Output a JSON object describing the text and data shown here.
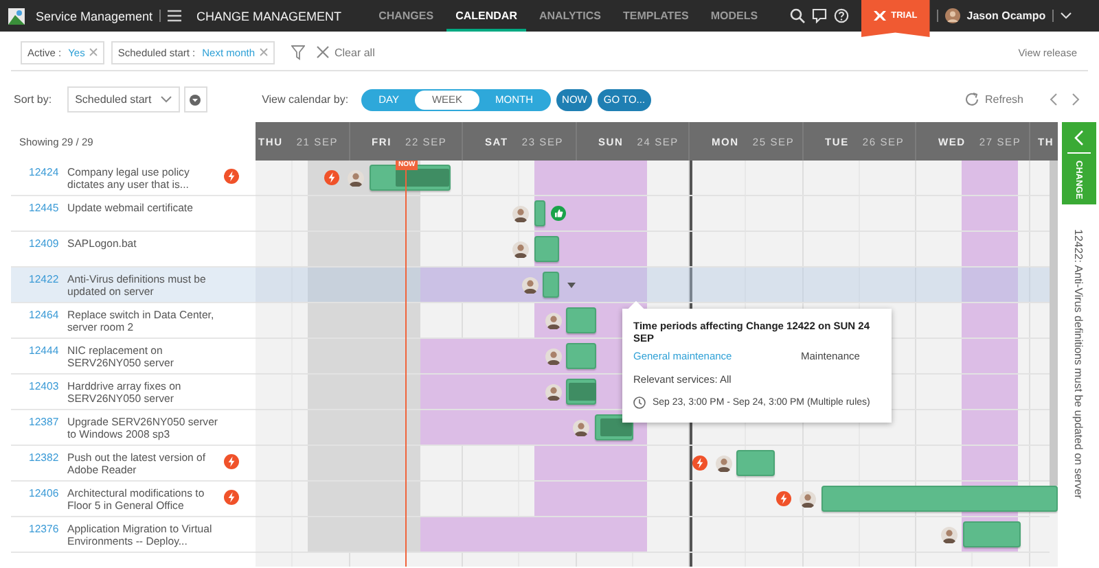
{
  "app": {
    "title": "Service Management",
    "module": "CHANGE MANAGEMENT",
    "trial": "TRIAL",
    "user": "Jason Ocampo"
  },
  "nav_tabs": [
    {
      "label": "CHANGES",
      "selected": false
    },
    {
      "label": "CALENDAR",
      "selected": true
    },
    {
      "label": "ANALYTICS",
      "selected": false
    },
    {
      "label": "TEMPLATES",
      "selected": false
    },
    {
      "label": "MODELS",
      "selected": false
    }
  ],
  "filters": [
    {
      "label": "Active :",
      "value": "Yes"
    },
    {
      "label": "Scheduled start :",
      "value": "Next month"
    }
  ],
  "clear_all": "Clear all",
  "view_release": "View release",
  "sort": {
    "label": "Sort by:",
    "value": "Scheduled start"
  },
  "view": {
    "label": "View calendar by:",
    "options": [
      {
        "label": "DAY",
        "selected": false
      },
      {
        "label": "WEEK",
        "selected": true
      },
      {
        "label": "MONTH",
        "selected": false
      }
    ]
  },
  "now_button": "NOW",
  "goto_button": "GO TO...",
  "refresh": "Refresh",
  "showing": "Showing 29 / 29",
  "days": [
    {
      "day": "THU",
      "date": "21 SEP"
    },
    {
      "day": "FRI",
      "date": "22 SEP"
    },
    {
      "day": "SAT",
      "date": "23 SEP"
    },
    {
      "day": "SUN",
      "date": "24 SEP"
    },
    {
      "day": "MON",
      "date": "25 SEP"
    },
    {
      "day": "TUE",
      "date": "26 SEP"
    },
    {
      "day": "WED",
      "date": "27 SEP"
    },
    {
      "day": "TH"
    }
  ],
  "now_marker": "NOW",
  "changes": [
    {
      "id": "12424",
      "title": "Company legal use policy dictates any user that is...",
      "emergency": true,
      "approved": false,
      "selected": false
    },
    {
      "id": "12445",
      "title": "Update webmail certificate",
      "emergency": false,
      "approved": true,
      "selected": false
    },
    {
      "id": "12409",
      "title": "SAPLogon.bat",
      "emergency": false,
      "approved": false,
      "selected": false
    },
    {
      "id": "12422",
      "title": "Anti-Virus definitions must be updated on server",
      "emergency": false,
      "approved": false,
      "selected": true
    },
    {
      "id": "12464",
      "title": "Replace switch in Data Center, server room 2",
      "emergency": false,
      "approved": false,
      "selected": false
    },
    {
      "id": "12444",
      "title": "NIC replacement on SERV26NY050 server",
      "emergency": false,
      "approved": false,
      "selected": false
    },
    {
      "id": "12403",
      "title": "Harddrive array fixes on SERV26NY050 server",
      "emergency": false,
      "approved": false,
      "selected": false
    },
    {
      "id": "12387",
      "title": "Upgrade SERV26NY050 server to Windows 2008 sp3",
      "emergency": false,
      "approved": false,
      "selected": false
    },
    {
      "id": "12382",
      "title": "Push out the latest version of Adobe Reader",
      "emergency": true,
      "approved": false,
      "selected": false
    },
    {
      "id": "12406",
      "title": "Architectural modifications to Floor 5 in General Office",
      "emergency": true,
      "approved": false,
      "selected": false
    },
    {
      "id": "12376",
      "title": "Application Migration to Virtual Environments -- Deploy...",
      "emergency": false,
      "approved": false,
      "selected": false
    }
  ],
  "popup": {
    "title": "Time periods affecting Change 12422 on SUN 24 SEP",
    "period": "General maintenance",
    "type": "Maintenance",
    "services": "Relevant services: All",
    "time": "Sep 23, 3:00 PM - Sep 24, 3:00 PM (Multiple rules)"
  },
  "side_panel": {
    "tab": "CHANGE",
    "title": "12422: Anti-Virus definitions must be updated on server"
  }
}
